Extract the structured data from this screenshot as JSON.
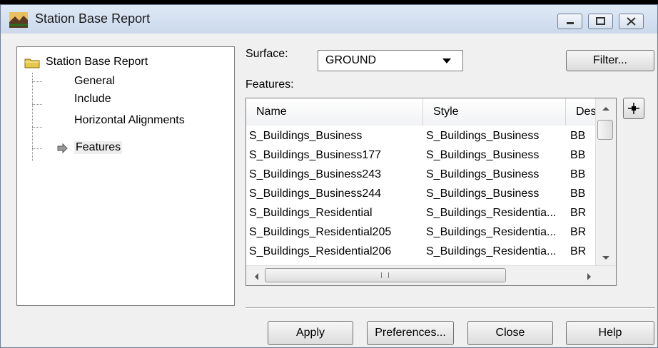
{
  "window": {
    "title": "Station Base Report"
  },
  "tree": {
    "root_label": "Station Base Report",
    "items": [
      {
        "label": "General"
      },
      {
        "label": "Include"
      },
      {
        "label": "Horizontal Alignments"
      },
      {
        "label": "Features"
      }
    ]
  },
  "surface": {
    "label": "Surface:",
    "value": "GROUND"
  },
  "filter_button": "Filter...",
  "features": {
    "label": "Features:",
    "columns": [
      "Name",
      "Style",
      "Des"
    ],
    "rows": [
      [
        "S_Buildings_Business",
        "S_Buildings_Business",
        "BB"
      ],
      [
        "S_Buildings_Business177",
        "S_Buildings_Business",
        "BB"
      ],
      [
        "S_Buildings_Business243",
        "S_Buildings_Business",
        "BB"
      ],
      [
        "S_Buildings_Business244",
        "S_Buildings_Business",
        "BB"
      ],
      [
        "S_Buildings_Residential",
        "S_Buildings_Residentia...",
        "BR"
      ],
      [
        "S_Buildings_Residential205",
        "S_Buildings_Residentia...",
        "BR"
      ],
      [
        "S_Buildings_Residential206",
        "S_Buildings_Residentia...",
        "BR"
      ]
    ]
  },
  "buttons": {
    "apply": "Apply",
    "preferences": "Preferences...",
    "close": "Close",
    "help": "Help"
  },
  "icons": [
    "app-icon",
    "folder-icon",
    "arrow-right-icon",
    "minimize-icon",
    "maximize-icon",
    "close-icon",
    "target-icon"
  ]
}
